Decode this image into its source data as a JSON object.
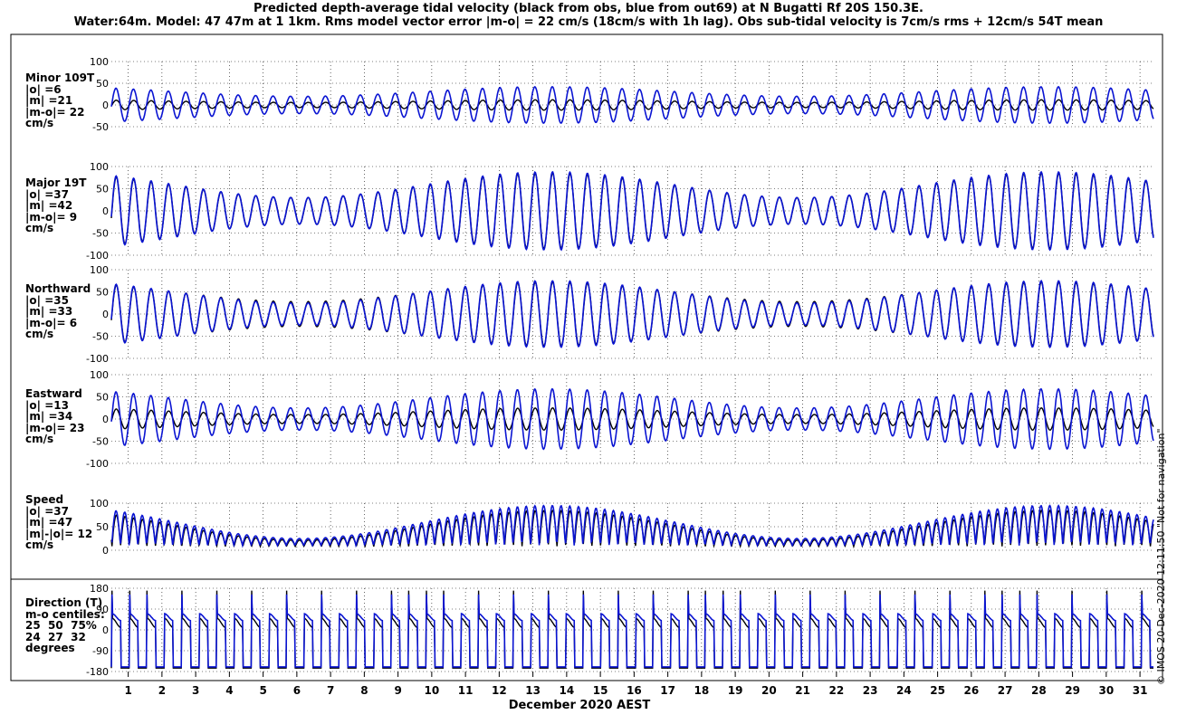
{
  "title": {
    "line1": "Predicted depth-average tidal velocity (black from obs, blue from out69) at N Bugatti Rf 20S 150.3E.",
    "line2": "Water:64m. Model: 47 47m at 1 1km. Rms model vector error |m-o| = 22 cm/s (18cm/s with 1h lag). Obs sub-tidal velocity is 7cm/s rms + 12cm/s 54T mean"
  },
  "credit": "© IMOS 20-Dec-2020 12:11:50  \"Not for navigation\"",
  "colors": {
    "obs": "#000000",
    "model": "#0a14d2",
    "grid": "#000000"
  },
  "chart_data": [
    {
      "type": "line",
      "panel_label": [
        "Minor 109T",
        "|o| =6",
        "|m| =21",
        "|m-o|= 22",
        "cm/s"
      ],
      "ylim": [
        -50,
        100
      ],
      "yticks": [
        -50,
        0,
        50,
        100
      ],
      "ytick_labels": [
        "-50",
        "0",
        "50",
        "100"
      ],
      "grid": true,
      "series": [
        {
          "amplitude_range": [
            6,
            12
          ]
        },
        {
          "amplitude_range": [
            20,
            42
          ]
        }
      ]
    },
    {
      "type": "line",
      "panel_label": [
        "Major 19T",
        "|o| =37",
        "|m| =42",
        "|m-o|= 9",
        "cm/s"
      ],
      "ylim": [
        -100,
        100
      ],
      "yticks": [
        -100,
        -50,
        0,
        50,
        100
      ],
      "ytick_labels": [
        "-100",
        "-50",
        "0",
        "50",
        "100"
      ],
      "grid": true,
      "series": [
        {
          "amplitude_range": [
            30,
            85
          ]
        },
        {
          "amplitude_range": [
            30,
            88
          ]
        }
      ]
    },
    {
      "type": "line",
      "panel_label": [
        "Northward",
        "|o| =35",
        "|m| =33",
        "|m-o|= 6",
        "cm/s"
      ],
      "ylim": [
        -100,
        100
      ],
      "yticks": [
        -100,
        -50,
        0,
        50,
        100
      ],
      "ytick_labels": [
        "-100",
        "-50",
        "0",
        "50",
        "100"
      ],
      "grid": true,
      "series": [
        {
          "amplitude_range": [
            28,
            72
          ]
        },
        {
          "amplitude_range": [
            25,
            75
          ]
        }
      ]
    },
    {
      "type": "line",
      "panel_label": [
        "Eastward",
        "|o| =13",
        "|m| =34",
        "|m-o|= 23",
        "cm/s"
      ],
      "ylim": [
        -100,
        100
      ],
      "yticks": [
        -100,
        -50,
        0,
        50,
        100
      ],
      "ytick_labels": [
        "-100",
        "-50",
        "0",
        "50",
        "100"
      ],
      "grid": true,
      "series": [
        {
          "amplitude_range": [
            10,
            25
          ]
        },
        {
          "amplitude_range": [
            25,
            68
          ]
        }
      ]
    },
    {
      "type": "line",
      "panel_label": [
        "Speed",
        "|o| =37",
        "|m| =47",
        "|m|-|o|= 12",
        "cm/s"
      ],
      "ylim": [
        0,
        100
      ],
      "yticks": [
        0,
        50,
        100
      ],
      "ytick_labels": [
        "0",
        "50",
        "100"
      ],
      "grid": true,
      "series": [
        {
          "range": [
            10,
            100
          ]
        },
        {
          "range": [
            10,
            100
          ]
        }
      ]
    },
    {
      "type": "line",
      "panel_label": [
        "Direction (T)",
        "m-o centiles:",
        "25  50  75%",
        "24  27  32",
        "degrees"
      ],
      "ylim": [
        -180,
        180
      ],
      "yticks": [
        -180,
        -90,
        0,
        90,
        180
      ],
      "ytick_labels": [
        "-180",
        "-90",
        "0",
        "90",
        "180"
      ],
      "grid": true,
      "series": [
        {
          "ebb_direction": -165,
          "flood_direction": 30,
          "peak": 170
        },
        {
          "ebb_direction": -160,
          "flood_direction": 55,
          "peak": 170
        }
      ]
    }
  ],
  "x_axis": {
    "label": "December 2020 AEST",
    "xlim": [
      0.5,
      31.4
    ],
    "ticks": [
      1,
      2,
      3,
      4,
      5,
      6,
      7,
      8,
      9,
      10,
      11,
      12,
      13,
      14,
      15,
      16,
      17,
      18,
      19,
      20,
      21,
      22,
      23,
      24,
      25,
      26,
      27,
      28,
      29,
      30,
      31
    ],
    "tick_labels": [
      "1",
      "2",
      "3",
      "4",
      "5",
      "6",
      "7",
      "8",
      "9",
      "10",
      "11",
      "12",
      "13",
      "14",
      "15",
      "16",
      "17",
      "18",
      "19",
      "20",
      "21",
      "22",
      "23",
      "24",
      "25",
      "26",
      "27",
      "28",
      "29",
      "30",
      "31"
    ]
  }
}
